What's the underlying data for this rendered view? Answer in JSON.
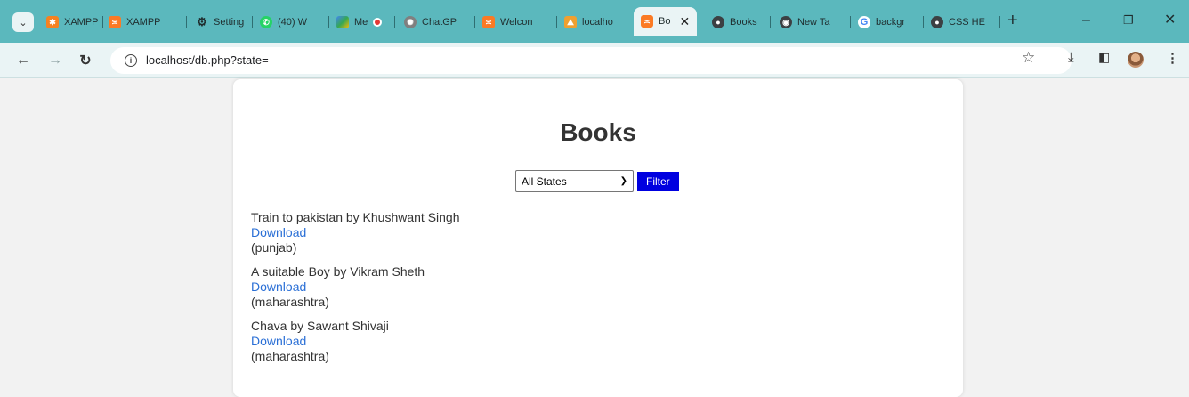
{
  "tabs": [
    {
      "label": "XAMPP",
      "icon": "xampp-icon",
      "color": "#f58220"
    },
    {
      "label": "XAMPP",
      "icon": "xampp-icon",
      "color": "#fb7a24"
    },
    {
      "label": "Setting",
      "icon": "gear-icon",
      "color": "#1f2d2e"
    },
    {
      "label": "(40) W",
      "icon": "whatsapp-icon",
      "color": "#25d366"
    },
    {
      "label": "Me",
      "icon": "meet-icon",
      "color": "#34a853"
    },
    {
      "label": "ChatGP",
      "icon": "chatgpt-icon",
      "color": "#808080"
    },
    {
      "label": "Welcon",
      "icon": "xampp-icon",
      "color": "#fb7a24"
    },
    {
      "label": "localho",
      "icon": "phpmyadmin-icon",
      "color": "#f0a030"
    },
    {
      "label": "Bo",
      "icon": "xampp-icon",
      "color": "#fb7a24",
      "active": true
    },
    {
      "label": "Books",
      "icon": "globe-icon",
      "color": "#3c4043"
    },
    {
      "label": "New Ta",
      "icon": "chrome-icon",
      "color": "#3c4043"
    },
    {
      "label": "backgr",
      "icon": "google-icon",
      "color": "#4285f4"
    },
    {
      "label": "CSS HE",
      "icon": "globe-icon",
      "color": "#3c4043"
    }
  ],
  "address_bar": {
    "url": "localhost/db.php?state="
  },
  "page": {
    "title": "Books",
    "filter": {
      "selected": "All States",
      "button_label": "Filter"
    },
    "books": [
      {
        "title_author": "Train to pakistan by Khushwant Singh",
        "link": "Download",
        "state": "(punjab)"
      },
      {
        "title_author": "A suitable Boy by Vikram Sheth",
        "link": "Download",
        "state": "(maharashtra)"
      },
      {
        "title_author": "Chava by Sawant Shivaji",
        "link": "Download",
        "state": "(maharashtra)"
      }
    ]
  },
  "colors": {
    "tabstrip": "#5bb8bd",
    "toolbar": "#eaf4f5",
    "filter_button": "#0000e0",
    "link": "#2a6fd6"
  }
}
